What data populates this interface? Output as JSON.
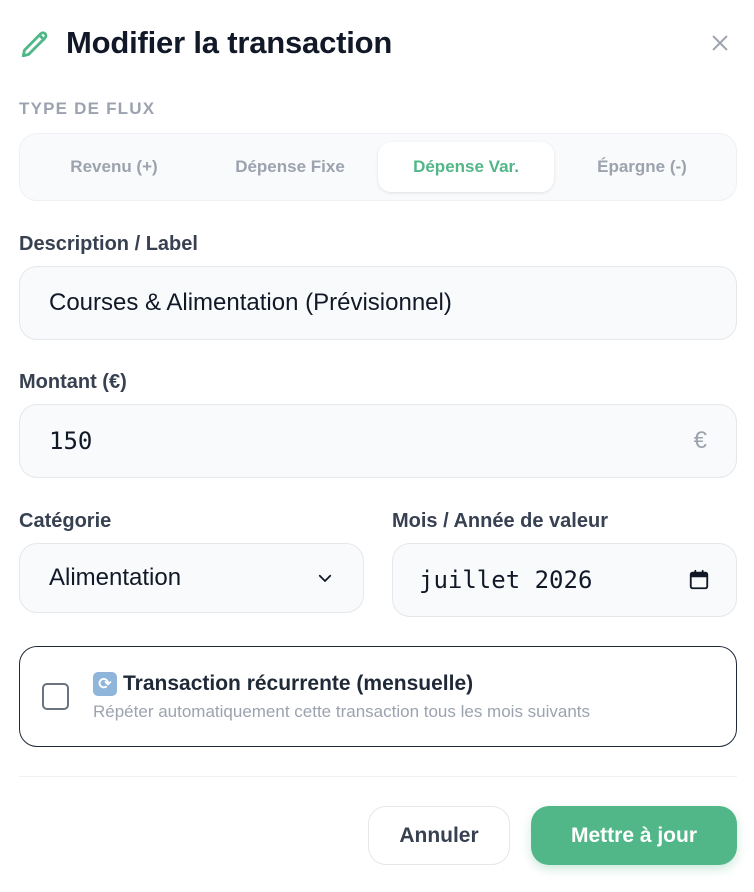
{
  "dialog": {
    "title": "Modifier la transaction",
    "close_icon": "close-icon",
    "edit_icon": "pencil-icon"
  },
  "flow_type": {
    "label": "TYPE DE FLUX",
    "options": [
      "Revenu (+)",
      "Dépense Fixe",
      "Dépense Var.",
      "Épargne (-)"
    ],
    "selected": "Dépense Var."
  },
  "description": {
    "label": "Description / Label",
    "value": "Courses & Alimentation (Prévisionnel)"
  },
  "amount": {
    "label": "Montant (€)",
    "value": "150",
    "currency_symbol": "€"
  },
  "category": {
    "label": "Catégorie",
    "value": "Alimentation"
  },
  "value_month": {
    "label": "Mois / Année de valeur",
    "value": "juillet 2026"
  },
  "recurring": {
    "checked": false,
    "title": "Transaction récurrente (mensuelle)",
    "description": "Répéter automatiquement cette transaction tous les mois suivants"
  },
  "actions": {
    "cancel_label": "Annuler",
    "submit_label": "Mettre à jour"
  },
  "colors": {
    "accent": "#52b788",
    "text": "#111827",
    "muted": "#9ca3af"
  }
}
